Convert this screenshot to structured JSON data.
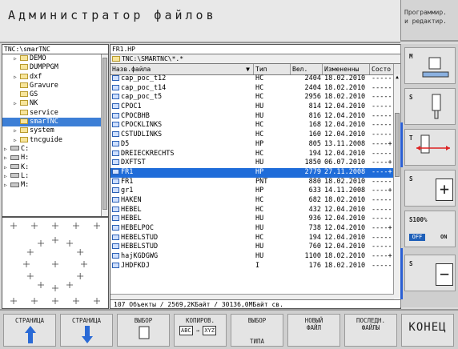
{
  "header": {
    "title": "Администратор файлов",
    "mode_line1": "Программир.",
    "mode_line2": "и редактир."
  },
  "tree": {
    "path": "TNC:\\smarTNC",
    "items": [
      {
        "label": "DEMO",
        "kind": "folder",
        "indent": 1,
        "arrow": "▷"
      },
      {
        "label": "DUMPPGM",
        "kind": "folder",
        "indent": 1,
        "arrow": ""
      },
      {
        "label": "dxf",
        "kind": "folder",
        "indent": 1,
        "arrow": "▷"
      },
      {
        "label": "Gravure",
        "kind": "folder",
        "indent": 1,
        "arrow": ""
      },
      {
        "label": "GS",
        "kind": "folder",
        "indent": 1,
        "arrow": ""
      },
      {
        "label": "NK",
        "kind": "folder",
        "indent": 1,
        "arrow": "▷"
      },
      {
        "label": "service",
        "kind": "folder",
        "indent": 1,
        "arrow": ""
      },
      {
        "label": "smarTNC",
        "kind": "folder",
        "indent": 1,
        "arrow": "",
        "selected": true
      },
      {
        "label": "system",
        "kind": "folder",
        "indent": 1,
        "arrow": "▷"
      },
      {
        "label": "tncguide",
        "kind": "folder",
        "indent": 1,
        "arrow": "▷"
      },
      {
        "label": "C:",
        "kind": "drive",
        "indent": 0,
        "arrow": "▷"
      },
      {
        "label": "H:",
        "kind": "drive",
        "indent": 0,
        "arrow": "▷"
      },
      {
        "label": "K:",
        "kind": "drive",
        "indent": 0,
        "arrow": "▷"
      },
      {
        "label": "L:",
        "kind": "drive",
        "indent": 0,
        "arrow": "▷"
      },
      {
        "label": "M:",
        "kind": "drive",
        "indent": 0,
        "arrow": "▷"
      }
    ]
  },
  "files": {
    "current": "FR1.HP",
    "path": "TNC:\\SMARTNC\\*.*",
    "columns": [
      "Назв.файла",
      "Тип",
      "Вел.",
      "Измененны",
      "Состо"
    ],
    "rows": [
      [
        "cap_poc_t12",
        "HC",
        "2404",
        "18.02.2010",
        "-----"
      ],
      [
        "cap_poc_t14",
        "HC",
        "2404",
        "18.02.2010",
        "-----"
      ],
      [
        "cap_poc_t5",
        "HC",
        "2956",
        "18.02.2010",
        "-----"
      ],
      [
        "CPOC1",
        "HU",
        "814",
        "12.04.2010",
        "-----"
      ],
      [
        "CPOCBHB",
        "HU",
        "816",
        "12.04.2010",
        "-----"
      ],
      [
        "CPOCKLINKS",
        "HC",
        "168",
        "12.04.2010",
        "-----"
      ],
      [
        "CSTUDLINKS",
        "HC",
        "160",
        "12.04.2010",
        "-----"
      ],
      [
        "D5",
        "HP",
        "805",
        "13.11.2008",
        "----+"
      ],
      [
        "DREIECKRECHTS",
        "HC",
        "194",
        "12.04.2010",
        "-----"
      ],
      [
        "DXFTST",
        "HU",
        "1850",
        "06.07.2010",
        "----+"
      ],
      [
        "FR1",
        "HP",
        "2779",
        "27.11.2008",
        "----+"
      ],
      [
        "FR1",
        "PNT",
        "880",
        "18.02.2010",
        "-----"
      ],
      [
        "gr1",
        "HP",
        "633",
        "14.11.2008",
        "----+"
      ],
      [
        "HAKEN",
        "HC",
        "682",
        "18.02.2010",
        "-----"
      ],
      [
        "HEBEL",
        "HC",
        "432",
        "12.04.2010",
        "-----"
      ],
      [
        "HEBEL",
        "HU",
        "936",
        "12.04.2010",
        "-----"
      ],
      [
        "HEBELPOC",
        "HU",
        "738",
        "12.04.2010",
        "----+"
      ],
      [
        "HEBELSTUD",
        "HC",
        "194",
        "12.04.2010",
        "-----"
      ],
      [
        "HEBELSTUD",
        "HU",
        "760",
        "12.04.2010",
        "-----"
      ],
      [
        "hajKGDGWG",
        "HU",
        "1100",
        "18.02.2010",
        "----+"
      ],
      [
        "JHDFKDJ",
        "I",
        "176",
        "18.02.2010",
        "-----"
      ]
    ],
    "selected_index": 10,
    "status": "107 Объекты / 2569,2КБайт / 30136,0МБайт св."
  },
  "side_softkeys": [
    {
      "label": "M"
    },
    {
      "label": "S"
    },
    {
      "label": "T"
    },
    {
      "label": "S",
      "extra": "+"
    },
    {
      "label": "S100%",
      "pill": "OFF",
      "pill2": "ON"
    },
    {
      "label": "S",
      "extra": "−"
    }
  ],
  "bottom_softkeys": [
    {
      "l1": "СТРАНИЦА",
      "l2": ""
    },
    {
      "l1": "СТРАНИЦА",
      "l2": ""
    },
    {
      "l1": "ВЫБОР",
      "l2": ""
    },
    {
      "l1": "КОПИРОВ.",
      "l2": ""
    },
    {
      "l1": "ВЫБОР",
      "l2": "ТИПА"
    },
    {
      "l1": "НОВЫЙ",
      "l2": "ФАЙЛ"
    },
    {
      "l1": "ПОСЛЕДН.",
      "l2": "ФАЙЛЫ"
    },
    {
      "l1": "КОНЕЦ",
      "l2": ""
    }
  ],
  "icons": {
    "copy_from": "ABC",
    "copy_to": "XYZ"
  },
  "colors": {
    "selection": "#1f6cd9",
    "folder": "#f7e59b",
    "accent": "#2a5fd4"
  }
}
